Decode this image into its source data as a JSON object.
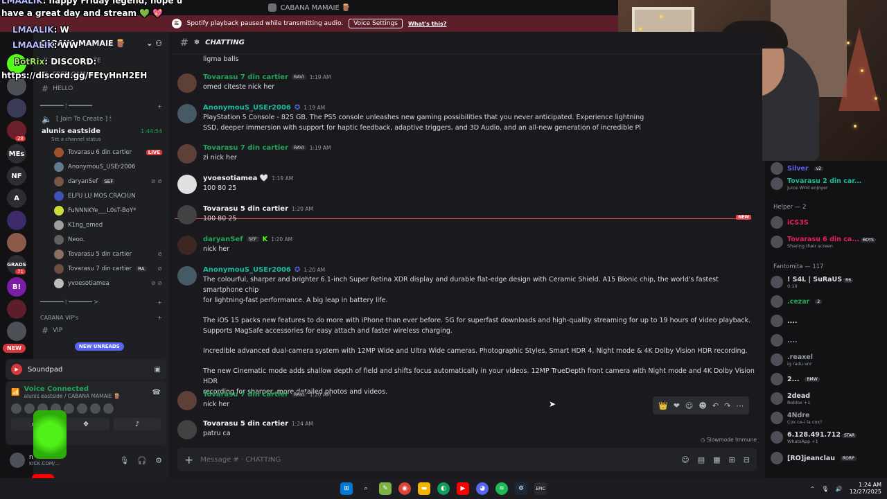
{
  "topbar": {
    "server_title": "CABANA MAMAIE 🪵"
  },
  "notice": {
    "icon": "spotify-icon",
    "text": "Spotify playback paused while transmitting audio.",
    "button": "Voice Settings",
    "link": "What's this?"
  },
  "stream_overlay": {
    "lines": [
      {
        "who": "LMAALIK",
        "text": ": happy Friday legend, hope u"
      },
      {
        "who": "",
        "text": "have a great day and stream 💚 💖"
      },
      {
        "who": "LMAALIK",
        "text": ": W"
      },
      {
        "who": "LMAALIK",
        "text": ": WW"
      },
      {
        "who": "BotRix",
        "text": ": DISCORD:"
      },
      {
        "who": "",
        "text": "https://discord.gg/FEtyHnH2EH"
      }
    ]
  },
  "rail": {
    "servers": [
      "K",
      "",
      "",
      "",
      "MEs",
      "NF",
      "A",
      "",
      "",
      "",
      "B!"
    ],
    "badges": [
      "28",
      "71"
    ],
    "new_label": "NEW"
  },
  "sidebar": {
    "server_name": "CABANA MAMAIE 🪵",
    "channels": [
      "SELF-PROMOTE",
      "FREE-GAMES",
      "HELLO"
    ],
    "category_1": "━━━━━━━ 🕯 ━━━━━━━",
    "join_to_create": "[ Join To Create ] 🕯",
    "voice_channel": {
      "name": "alunis eastside",
      "time": "1:44:54",
      "status": "Set a channel status"
    },
    "users": [
      {
        "name": "Tovarasu 6 din cartier",
        "live": "LIVE"
      },
      {
        "name": "AnonymouS_USEr2006"
      },
      {
        "name": "daryanSef",
        "tag": "SEF"
      },
      {
        "name": "ELFU LU MOS CRACIUN"
      },
      {
        "name": "FuNNNKYe___L0sT-BoY*"
      },
      {
        "name": "K1ng_omed"
      },
      {
        "name": "Neoo."
      },
      {
        "name": "Tovarasu 5 din cartier"
      },
      {
        "name": "Tovarasu 7 din cartier",
        "tag": "RA"
      },
      {
        "name": "yvoesotiamea"
      }
    ],
    "category_2": "━━━━━━━ 🕯 ━━━━━━━ >",
    "vip_category": "CABANA VIP's",
    "vip_channel": "VIP",
    "new_unreads": "NEW UNREADS"
  },
  "soundpad": {
    "label": "Soundpad"
  },
  "voice_panel": {
    "title": "Voice Connected",
    "subtitle": "alunis eastside / CABANA MAMAIE 🪵"
  },
  "userbar": {
    "name": "n",
    "sub": "KICK.COM/..."
  },
  "chat": {
    "channel": "CHATTING",
    "messages": [
      {
        "user": "",
        "time": "",
        "body": "ligma balls"
      },
      {
        "user": "Tovarasu 7 din cartier",
        "tag": "RAVI",
        "time": "1:19 AM",
        "body": "omed citeste nick her"
      },
      {
        "user": "AnonymouS_USEr2006",
        "time": "1:19 AM",
        "body": "PlayStation 5 Console - 825 GB. The PS5 console unleashes new gaming possibilities that you never anticipated. Experience lightning\nSSD, deeper immersion with support for haptic feedback, adaptive triggers, and 3D Audio, and an all-new generation of incredible Pl"
      },
      {
        "user": "Tovarasu 7 din cartier",
        "tag": "RAVI",
        "time": "1:19 AM",
        "body": "zi nick her"
      },
      {
        "user": "yvoesotiamea 🤍",
        "time": "1:19 AM",
        "body": "100 80 25"
      },
      {
        "user": "Tovarasu 5 din cartier",
        "time": "1:20 AM",
        "body": "100 80 25"
      },
      {
        "user": "daryanSef",
        "tag": "SEF",
        "time": "1:20 AM",
        "body": "nick her"
      },
      {
        "user": "AnonymouS_USEr2006",
        "time": "1:20 AM",
        "body": "The colourful, sharper and brighter 6.1-inch Super Retina XDR display and durable flat-edge design with Ceramic Shield. A15 Bionic chip, the world's fastest smartphone chip\nfor lightning-fast performance. A big leap in battery life."
      },
      {
        "user": "",
        "time": "",
        "body": "The iOS 15 packs new features to do more with iPhone than ever before. 5G for superfast downloads and high-quality streaming for up to 19 hours of video playback.\nSupports MagSafe accessories for easy attach and faster wireless charging."
      },
      {
        "user": "",
        "time": "",
        "body": "Incredible advanced dual-camera system with 12MP Wide and Ultra Wide cameras. Photographic Styles, Smart HDR 4, Night mode & 4K Dolby Vision HDR recording."
      },
      {
        "user": "",
        "time": "",
        "body": "The new Cinematic mode adds shallow depth of field and shifts focus automatically in your videos. 12MP TrueDepth front camera with Night mode and 4K Dolby Vision HDR\nrecording for sharper, more detailed photos and videos."
      },
      {
        "user": "Tovarasu 7 din cartier",
        "tag": "RAVI",
        "time": "1:20 AM",
        "body": "nick her"
      },
      {
        "user": "Tovarasu 5 din cartier",
        "time": "1:24 AM",
        "body": "patru ca"
      }
    ],
    "new_marker": "NEW",
    "slowmode": "Slowmode Immune",
    "composer_placeholder": "Message # · CHATTING"
  },
  "members": {
    "items": [
      {
        "name": "Silver",
        "pill": "v2",
        "color": "#5865f2"
      },
      {
        "name": "Tovarasu 2 din car...",
        "sub": "Juice Wrld enjoyer",
        "color": "#1abc9c"
      },
      {
        "category": "Helper — 2"
      },
      {
        "name": "iCS3S",
        "color": "#e91e63"
      },
      {
        "name": "Tovarasu 6 din ca...",
        "pill": "BOYS",
        "sub": "Sharing their screen",
        "color": "#e91e63"
      },
      {
        "category": "Fantomita — 117"
      },
      {
        "name": "! S4L | SuRaUS",
        "pill": "R6",
        "sub": "0:10",
        "color": "#dbdee1"
      },
      {
        "name": ".cezar",
        "pill": "2",
        "color": "#23a55a"
      },
      {
        "name": "....",
        "color": "#dbdee1"
      },
      {
        "name": "....",
        "color": "#949ba4"
      },
      {
        "name": ".reaxel",
        "sub": "ig radu.vnr",
        "color": "#949ba4"
      },
      {
        "name": "2...",
        "pill": "BMW",
        "color": "#dbdee1"
      },
      {
        "name": "2dead",
        "sub": "Roblox +1",
        "color": "#dbdee1"
      },
      {
        "name": "4Ndre",
        "sub": "Cox ce-i la cox?",
        "color": "#949ba4"
      },
      {
        "name": "6.128.491.712",
        "pill": "STAR",
        "sub": "WhatsApp +1",
        "color": "#dbdee1"
      },
      {
        "name": "[RO]jeanclau",
        "pill": "RORP",
        "color": "#dbdee1"
      }
    ]
  },
  "taskbar": {
    "icons": [
      "windows-icon",
      "search-icon",
      "notepad-icon",
      "chrome-icon",
      "folder-icon",
      "edge-icon",
      "youtube-icon",
      "discord-icon",
      "spotify-icon",
      "steam-icon",
      "epic-icon"
    ],
    "time": "1:24 AM",
    "date": "12/27/2025"
  }
}
